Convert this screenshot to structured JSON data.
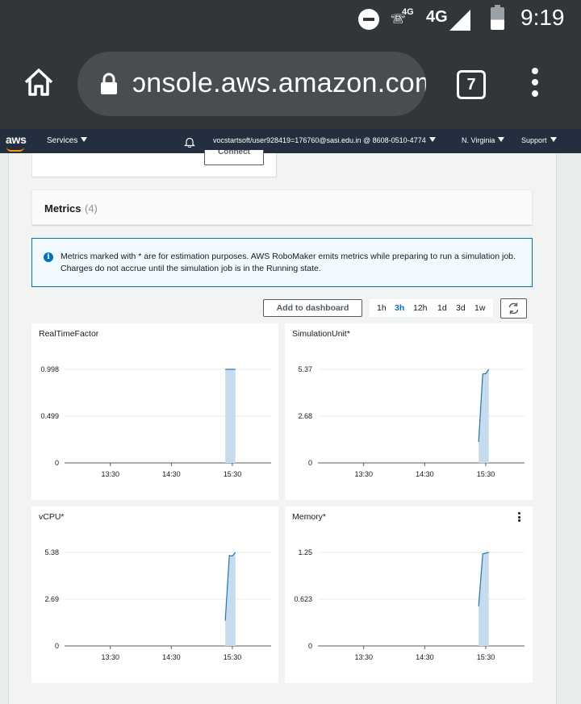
{
  "status_bar": {
    "call_network": "4G",
    "network": "4G",
    "time": "9:19"
  },
  "browser": {
    "url": "ɔnsole.aws.amazon.com",
    "tab_count": "7"
  },
  "aws_nav": {
    "logo": "aws",
    "services": "Services",
    "account": "vocstartsoft/user928419=176760@sasi.edu.in @ 8608-0510-4774",
    "region": "N. Virginia",
    "support": "Support"
  },
  "previous_panel": {
    "connect_label": "Connect"
  },
  "metrics": {
    "title": "Metrics",
    "count": "(4)",
    "info": "Metrics marked with * are for estimation purposes. AWS RoboMaker emits metrics while preparing to run a simulation job. Charges do not accrue until the simulation job is in the Running state.",
    "add_dashboard": "Add to dashboard",
    "ranges": [
      "1h",
      "3h",
      "12h",
      "1d",
      "3d",
      "1w"
    ],
    "active_range": "3h"
  },
  "chart_data": [
    {
      "type": "area",
      "title": "RealTimeFactor",
      "xlabel": "",
      "ylabel": "",
      "x_ticks": [
        "13:30",
        "14:30",
        "15:30"
      ],
      "y_ticks": [
        "0",
        "0.499",
        "0.998"
      ],
      "ylim": [
        0,
        0.998
      ],
      "x": [
        "15:23",
        "15:26",
        "15:30",
        "15:33"
      ],
      "series": [
        {
          "values": [
            0.998,
            0.998,
            0.998,
            0.998
          ]
        }
      ],
      "color": "#1f77b4",
      "grid": true
    },
    {
      "type": "area",
      "title": "SimulationUnit*",
      "xlabel": "",
      "ylabel": "",
      "x_ticks": [
        "13:30",
        "14:30",
        "15:30"
      ],
      "y_ticks": [
        "0",
        "2.68",
        "5.37"
      ],
      "ylim": [
        0,
        5.37
      ],
      "x": [
        "15:23",
        "15:27",
        "15:30",
        "15:33"
      ],
      "series": [
        {
          "values": [
            1.2,
            5.1,
            5.12,
            5.37
          ]
        }
      ],
      "color": "#1f77b4",
      "grid": true
    },
    {
      "type": "area",
      "title": "vCPU*",
      "xlabel": "",
      "ylabel": "",
      "x_ticks": [
        "13:30",
        "14:30",
        "15:30"
      ],
      "y_ticks": [
        "0",
        "2.69",
        "5.38"
      ],
      "ylim": [
        0,
        5.38
      ],
      "x": [
        "15:23",
        "15:27",
        "15:30",
        "15:33"
      ],
      "series": [
        {
          "values": [
            1.45,
            5.2,
            5.17,
            5.38
          ]
        }
      ],
      "color": "#1f77b4",
      "grid": true
    },
    {
      "type": "area",
      "title": "Memory*",
      "xlabel": "",
      "ylabel": "",
      "x_ticks": [
        "13:30",
        "14:30",
        "15:30"
      ],
      "y_ticks": [
        "0",
        "0.623",
        "1.25"
      ],
      "ylim": [
        0,
        1.25
      ],
      "x": [
        "15:23",
        "15:27",
        "15:30",
        "15:33"
      ],
      "series": [
        {
          "values": [
            0.53,
            1.23,
            1.24,
            1.25
          ]
        }
      ],
      "color": "#1f77b4",
      "grid": true
    }
  ]
}
